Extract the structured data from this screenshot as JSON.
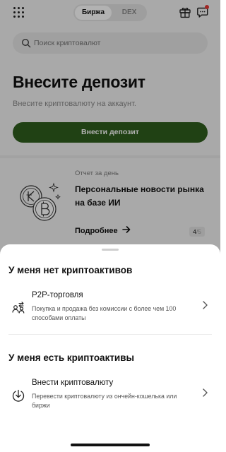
{
  "header": {
    "tabs": [
      {
        "label": "Биржа",
        "active": true
      },
      {
        "label": "DEX",
        "active": false
      }
    ],
    "icons": [
      "grid-icon",
      "gift-icon",
      "chat-icon"
    ],
    "notification_color": "#e53935"
  },
  "search": {
    "placeholder": "Поиск криптовалют"
  },
  "deposit": {
    "title": "Внесите депозит",
    "subtitle": "Внесите криптовалюту на аккаунт.",
    "button_label": "Внести депозит",
    "button_color": "#2f5d1e"
  },
  "news": {
    "kicker": "Отчет за день",
    "title": "Персональные новости рынка на базе ИИ",
    "more_label": "Подробнее",
    "page_current": "4",
    "page_total": "/5"
  },
  "sheet": {
    "section1": {
      "title": "У меня нет криптоактивов",
      "option": {
        "title": "P2P-торговля",
        "description": "Покупка и продажа без комиссии с более чем 100 способами оплаты",
        "icon": "p2p-icon"
      }
    },
    "section2": {
      "title": "У меня есть криптоактивы",
      "option": {
        "title": "Внести криптовалюту",
        "description": "Перевести криптовалюту из ончейн-кошелька или биржи",
        "icon": "deposit-icon"
      }
    }
  }
}
